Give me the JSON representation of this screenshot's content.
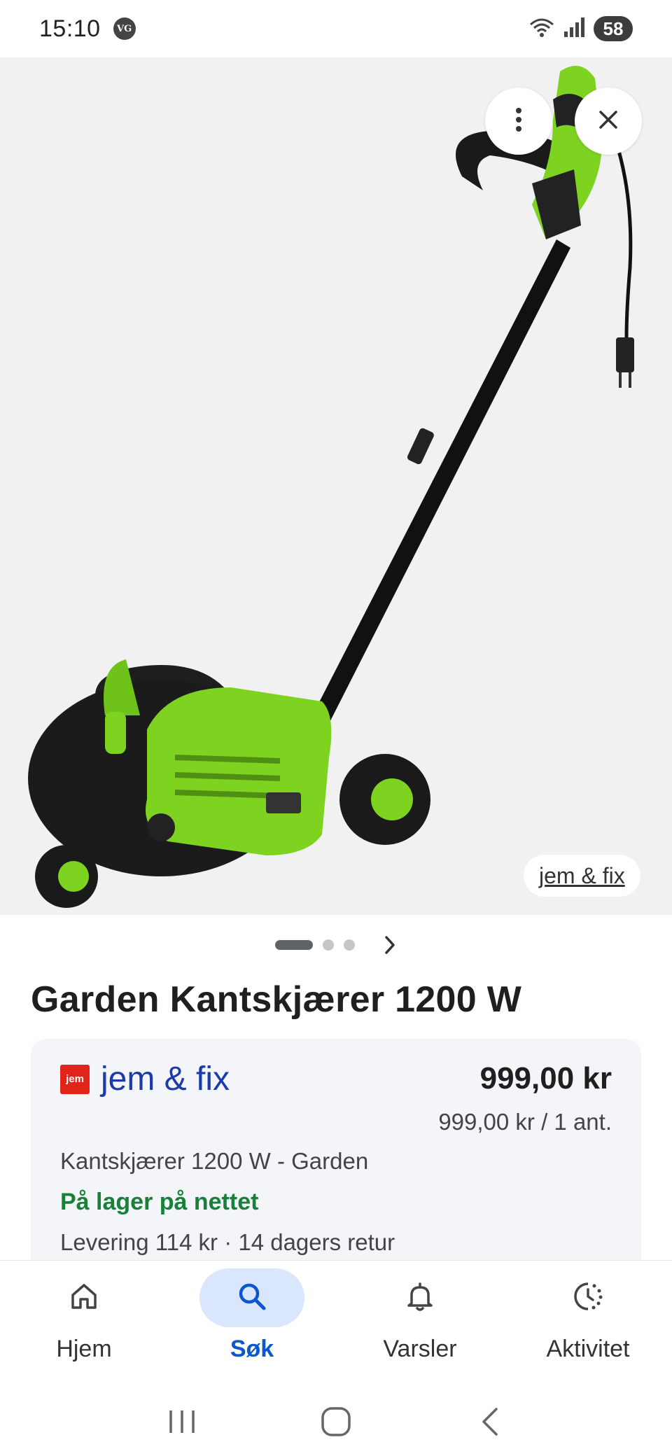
{
  "status_bar": {
    "time": "15:10",
    "app_badge": "VG",
    "battery": "58"
  },
  "hero": {
    "image_subject": "green-lawn-edger",
    "source_chip": "jem & fix",
    "more_icon": "more-vert-icon",
    "close_icon": "close-icon"
  },
  "carousel": {
    "total": 3,
    "active": 1
  },
  "product": {
    "title": "Garden Kantskjærer 1200 W"
  },
  "offer": {
    "merchant_logo": "jem",
    "merchant_name": "jem & fix",
    "price": "999,00 kr",
    "unit_price": "999,00 kr / 1 ant.",
    "description": "Kantskjærer 1200 W - Garden",
    "stock": "På lager på nettet",
    "delivery": "Levering 114 kr · 14 dagers retur",
    "colors": {
      "stock": "#188038",
      "merchant": "#1a3ca8",
      "logo": "#e2231a"
    }
  },
  "bottom_nav": {
    "items": [
      {
        "label": "Hjem",
        "icon": "home-icon"
      },
      {
        "label": "Søk",
        "icon": "search-icon",
        "active": true
      },
      {
        "label": "Varsler",
        "icon": "bell-icon"
      },
      {
        "label": "Aktivitet",
        "icon": "activity-icon"
      }
    ]
  },
  "system_nav": {
    "recents": "recents-icon",
    "home": "home-circle-icon",
    "back": "back-icon"
  }
}
